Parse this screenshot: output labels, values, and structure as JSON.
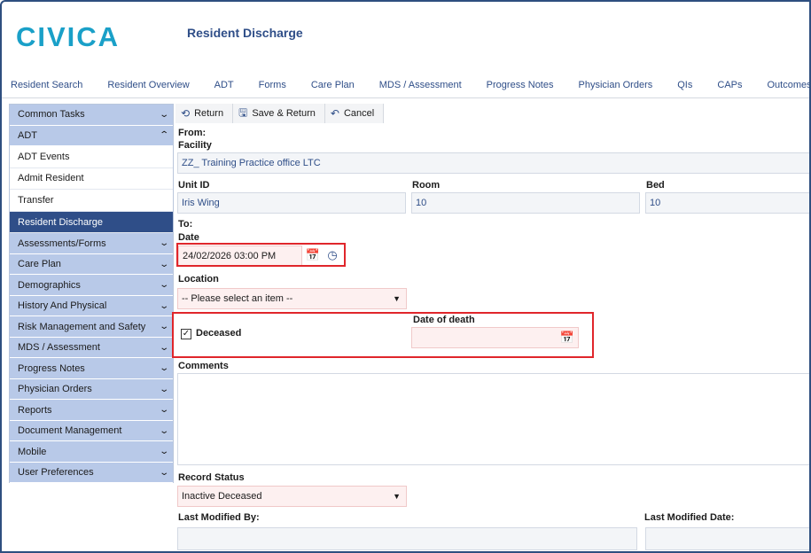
{
  "brand": {
    "logo_text": "CIVICA"
  },
  "header": {
    "title": "Resident Discharge"
  },
  "top_nav": [
    "Resident Search",
    "Resident Overview",
    "ADT",
    "Forms",
    "Care Plan",
    "MDS / Assessment",
    "Progress Notes",
    "Physician Orders",
    "QIs",
    "CAPs",
    "Outcomes"
  ],
  "sidebar": {
    "sections_top": [
      {
        "label": "Common Tasks",
        "chevron": "down"
      },
      {
        "label": "ADT",
        "chevron": "up"
      }
    ],
    "adt_items": [
      {
        "label": "ADT Events",
        "active": false
      },
      {
        "label": "Admit Resident",
        "active": false
      },
      {
        "label": "Transfer",
        "active": false
      },
      {
        "label": "Resident Discharge",
        "active": true
      }
    ],
    "sections_bottom": [
      {
        "label": "Assessments/Forms"
      },
      {
        "label": "Care Plan"
      },
      {
        "label": "Demographics"
      },
      {
        "label": "History And Physical"
      },
      {
        "label": "Risk Management and Safety"
      },
      {
        "label": "MDS / Assessment"
      },
      {
        "label": "Progress Notes"
      },
      {
        "label": "Physician Orders"
      },
      {
        "label": "Reports"
      },
      {
        "label": "Document Management"
      },
      {
        "label": "Mobile"
      },
      {
        "label": "User Preferences"
      }
    ]
  },
  "toolbar": {
    "return_label": "Return",
    "save_return_label": "Save & Return",
    "cancel_label": "Cancel"
  },
  "form": {
    "from_label": "From:",
    "facility_label": "Facility",
    "facility_value": "ZZ_ Training Practice office LTC",
    "unit_label": "Unit ID",
    "unit_value": "Iris Wing",
    "room_label": "Room",
    "room_value": "10",
    "bed_label": "Bed",
    "bed_value": "10",
    "to_label": "To:",
    "date_label": "Date",
    "date_value": "24/02/2026 03:00 PM",
    "location_label": "Location",
    "location_value": "-- Please select an item --",
    "deceased_label": "Deceased",
    "deceased_checked": true,
    "date_of_death_label": "Date of death",
    "date_of_death_value": "",
    "comments_label": "Comments",
    "record_status_label": "Record Status",
    "record_status_value": "Inactive Deceased",
    "last_modified_by_label": "Last Modified By:",
    "last_modified_by_value": "",
    "last_modified_date_label": "Last Modified Date:",
    "last_modified_date_value": ""
  },
  "colors": {
    "brand": "#1aa0c8",
    "nav_text": "#2f4e88",
    "sidebar_section_bg": "#b8c9e8",
    "sidebar_active_bg": "#2f4e88",
    "highlight_red": "#e0262b"
  },
  "icons": {
    "return": "return-icon",
    "save": "save-icon",
    "cancel": "undo-icon",
    "calendar": "calendar-icon",
    "clock": "clock-icon",
    "dropdown": "caret-down-icon",
    "checkbox": "checkmark-icon"
  }
}
